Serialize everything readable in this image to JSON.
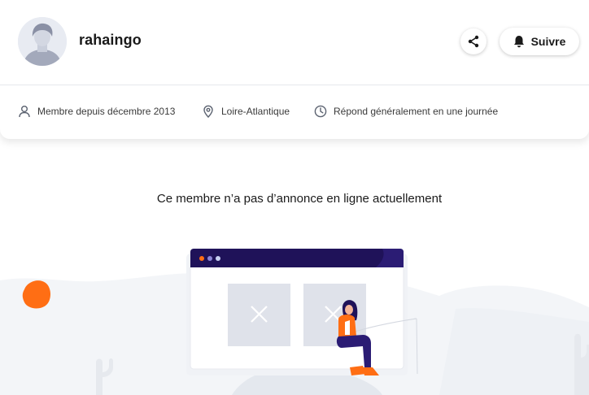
{
  "profile": {
    "username": "rahaingo",
    "follow_label": "Suivre"
  },
  "info": {
    "member_since": "Membre depuis décembre 2013",
    "location": "Loire-Atlantique",
    "response_time": "Répond généralement en une journée"
  },
  "empty_state": {
    "message": "Ce membre n’a pas d’annonce en ligne actuellement"
  },
  "icons": {
    "share": "share-icon",
    "follow": "bell-icon",
    "member": "user-icon",
    "location": "location-pin-icon",
    "response": "clock-icon"
  },
  "colors": {
    "accent_orange": "#ff6e14",
    "browser_bar": "#1f1259",
    "background_shape": "#f3f5f8"
  }
}
